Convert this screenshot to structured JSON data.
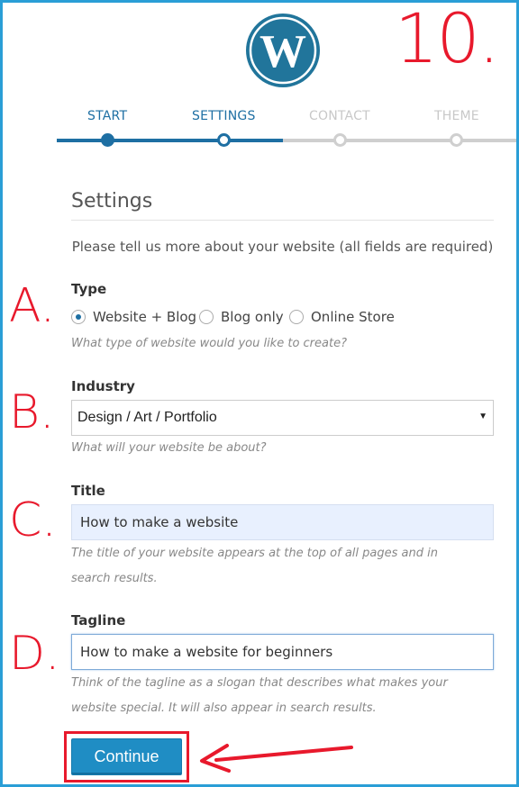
{
  "annotations": {
    "step_number": "10.",
    "letter_a": "A.",
    "letter_b": "B.",
    "letter_c": "C.",
    "letter_d": "D."
  },
  "brand": {
    "logo_icon": "wordpress-logo-icon",
    "color": "#21759b"
  },
  "stepper": {
    "steps": [
      {
        "label": "START",
        "state": "completed"
      },
      {
        "label": "SETTINGS",
        "state": "current"
      },
      {
        "label": "CONTACT",
        "state": "upcoming"
      },
      {
        "label": "THEME",
        "state": "upcoming"
      }
    ],
    "active_color": "#1e6fa3",
    "inactive_color": "#cfcfcf"
  },
  "settings": {
    "title": "Settings",
    "intro": "Please tell us more about your website (all fields are required)",
    "type": {
      "label": "Type",
      "options": [
        {
          "label": "Website + Blog",
          "checked": true
        },
        {
          "label": "Blog only",
          "checked": false
        },
        {
          "label": "Online Store",
          "checked": false
        }
      ],
      "hint": "What type of website would you like to create?"
    },
    "industry": {
      "label": "Industry",
      "selected": "Design / Art / Portfolio",
      "hint": "What will your website be about?"
    },
    "title_field": {
      "label": "Title",
      "value": "How to make a website",
      "hint": "The title of your website appears at the top of all pages and in search results."
    },
    "tagline": {
      "label": "Tagline",
      "value": "How to make a website for beginners",
      "hint": "Think of the tagline as a slogan that describes what makes your website special. It will also appear in search results."
    },
    "continue_label": "Continue",
    "button_color": "#1f8dc4",
    "highlight_color": "#e8192c"
  }
}
